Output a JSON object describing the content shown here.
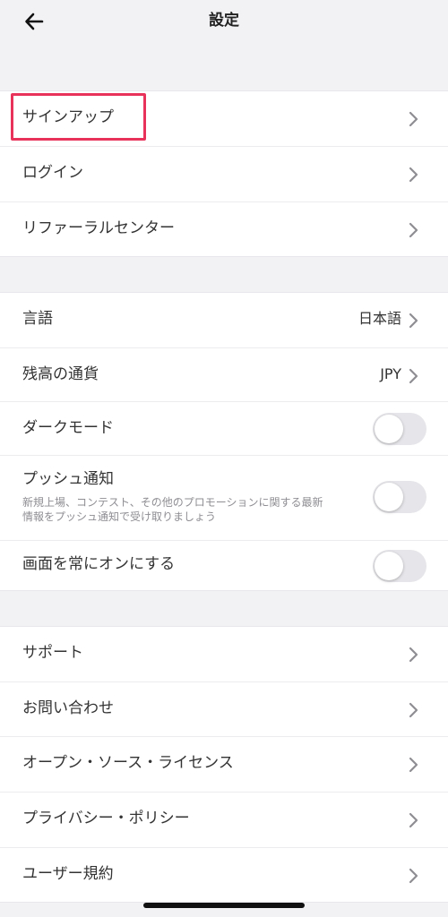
{
  "header": {
    "title": "設定"
  },
  "account": {
    "signup": "サインアップ",
    "login": "ログイン",
    "referral": "リファーラルセンター"
  },
  "settings": {
    "language_label": "言語",
    "language_value": "日本語",
    "currency_label": "残高の通貨",
    "currency_value": "JPY",
    "dark_mode_label": "ダークモード",
    "dark_mode_on": false,
    "push_label": "プッシュ通知",
    "push_desc_line1": "新規上場、コンテスト、その他のプロモーションに関する最新",
    "push_desc_line2": "情報をプッシュ通知で受け取りましょう",
    "push_on": false,
    "screen_on_label": "画面を常にオンにする",
    "screen_on_on": false
  },
  "info": {
    "support": "サポート",
    "contact": "お問い合わせ",
    "oss": "オープン・ソース・ライセンス",
    "privacy": "プライバシー・ポリシー",
    "terms": "ユーザー規約"
  },
  "colors": {
    "highlight": "#e8325a",
    "background": "#f2f2f5"
  },
  "icons": {
    "back": "arrow-left-icon",
    "chevron": "chevron-right-icon"
  }
}
